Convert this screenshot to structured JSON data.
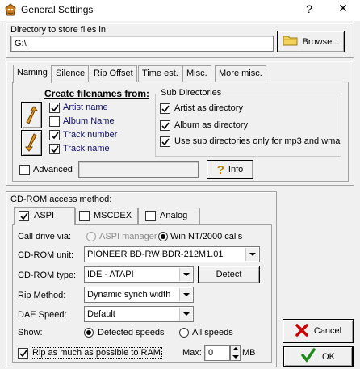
{
  "window": {
    "title": "General Settings",
    "help_glyph": "?",
    "close_glyph": "✕"
  },
  "directory": {
    "label": "Directory to store files in:",
    "value": "G:\\",
    "browse_label": "Browse..."
  },
  "tabs": [
    {
      "label": "Naming",
      "active": true
    },
    {
      "label": "Silence"
    },
    {
      "label": "Rip Offset"
    },
    {
      "label": "Time est."
    },
    {
      "label": "Misc."
    },
    {
      "label": "More misc."
    }
  ],
  "naming": {
    "create_heading": "Create filenames from:",
    "fields": [
      {
        "label": "Artist name",
        "checked": true
      },
      {
        "label": "Album Name",
        "checked": false
      },
      {
        "label": "Track number",
        "checked": true
      },
      {
        "label": "Track name",
        "checked": true
      }
    ],
    "subdir_heading": "Sub Directories",
    "subdirs": [
      {
        "label": "Artist as directory",
        "checked": true
      },
      {
        "label": "Album as directory",
        "checked": true
      },
      {
        "label": "Use sub directories only for mp3 and wma",
        "checked": true
      }
    ],
    "advanced_label": "Advanced",
    "advanced_value": "",
    "info_label": "Info",
    "info_glyph": "?"
  },
  "cdrom": {
    "heading": "CD-ROM access method:",
    "tabs": [
      {
        "label": "ASPI",
        "checked": true,
        "active": true
      },
      {
        "label": "MSCDEX",
        "checked": false
      },
      {
        "label": "Analog",
        "checked": false
      }
    ],
    "call_drive_label": "Call drive via:",
    "call_options": [
      {
        "label": "ASPI manager",
        "selected": false,
        "disabled": true
      },
      {
        "label": "Win NT/2000 calls",
        "selected": true
      }
    ],
    "unit_label": "CD-ROM unit:",
    "unit_value": "PIONEER BD-RW   BDR-212M1.01",
    "type_label": "CD-ROM type:",
    "type_value": "IDE   - ATAPI",
    "detect_label": "Detect",
    "rip_label": "Rip Method:",
    "rip_value": "Dynamic synch width",
    "dae_label": "DAE Speed:",
    "dae_value": "Default",
    "show_label": "Show:",
    "show_options": [
      {
        "label": "Detected speeds",
        "selected": true
      },
      {
        "label": "All speeds",
        "selected": false
      }
    ],
    "ram_label": "Rip as much as possible to RAM",
    "ram_checked": true,
    "max_label": "Max:",
    "max_value": "0",
    "mb_label": "MB"
  },
  "buttons": {
    "cancel_label": "Cancel",
    "ok_label": "OK"
  },
  "colors": {
    "accent_navy": "#101060",
    "cancel_x": "#cc0000",
    "ok_check": "#1a8a1a",
    "arrow_orange": "#d98a00"
  }
}
